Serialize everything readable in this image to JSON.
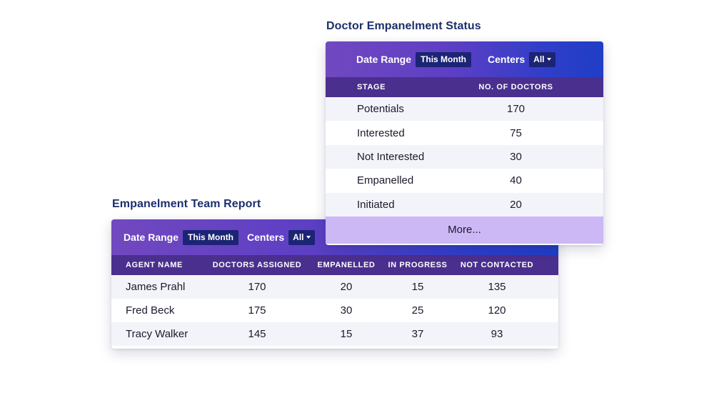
{
  "status_panel": {
    "title": "Doctor Empanelment Status",
    "filters": {
      "date_range_label": "Date Range",
      "date_range_value": "This Month",
      "centers_label": "Centers",
      "centers_value": "All"
    },
    "columns": [
      "STAGE",
      "NO. OF DOCTORS"
    ],
    "rows": [
      {
        "stage": "Potentials",
        "count": "170"
      },
      {
        "stage": "Interested",
        "count": "75"
      },
      {
        "stage": "Not Interested",
        "count": "30"
      },
      {
        "stage": "Empanelled",
        "count": "40"
      },
      {
        "stage": "Initiated",
        "count": "20"
      }
    ],
    "more_label": "More..."
  },
  "team_report": {
    "title": "Empanelment Team Report",
    "filters": {
      "date_range_label": "Date Range",
      "date_range_value": "This Month",
      "centers_label": "Centers",
      "centers_value": "All"
    },
    "columns": [
      "AGENT NAME",
      "DOCTORS ASSIGNED",
      "EMPANELLED",
      "IN PROGRESS",
      "NOT CONTACTED"
    ],
    "rows": [
      {
        "agent": "James Prahl",
        "assigned": "170",
        "empanelled": "20",
        "in_progress": "15",
        "not_contacted": "135"
      },
      {
        "agent": "Fred Beck",
        "assigned": "175",
        "empanelled": "30",
        "in_progress": "25",
        "not_contacted": "120"
      },
      {
        "agent": "Tracy Walker",
        "assigned": "145",
        "empanelled": "15",
        "in_progress": "37",
        "not_contacted": "93"
      }
    ]
  },
  "colors": {
    "title": "#1c2f6b",
    "header_gradient_start": "#7148c0",
    "header_gradient_end": "#1f3ec6",
    "pill": "#1c2475",
    "table_head": "#4a2f8f",
    "row_alt": "#f3f4f9",
    "more_button": "#ccb8f4"
  }
}
